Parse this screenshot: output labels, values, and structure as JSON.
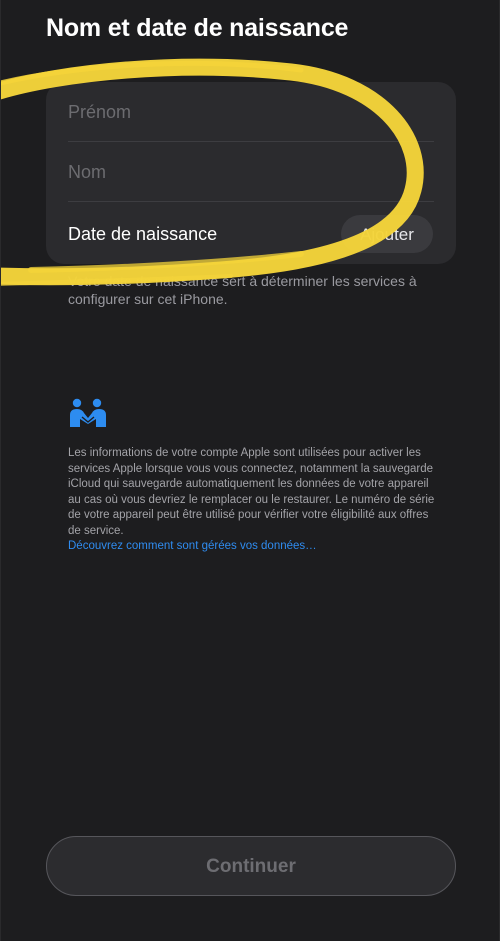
{
  "header": {
    "title": "Nom et date de naissance"
  },
  "form": {
    "first_name_placeholder": "Prénom",
    "last_name_placeholder": "Nom",
    "birth_date_label": "Date de naissance",
    "add_button_label": "Ajouter"
  },
  "helper": {
    "text": "Votre date de naissance sert à déterminer les services à configurer sur cet iPhone."
  },
  "privacy": {
    "icon": "people-handshake-icon",
    "text": "Les informations de votre compte Apple sont utilisées pour activer les services Apple lorsque vous vous connectez, notamment la sauvegarde iCloud qui sauvegarde automatiquement les données de votre appareil au cas où vous devriez le remplacer ou le restaurer. Le numéro de série de votre appareil peut être utilisé pour vérifier votre éligibilité aux offres de service.",
    "link_label": "Découvrez comment sont gérées vos données…"
  },
  "footer": {
    "continue_label": "Continuer"
  },
  "colors": {
    "background": "#1d1d1f",
    "card": "#2b2b2e",
    "link": "#2f8cf0",
    "annotation_yellow": "#f4d43a",
    "icon_blue": "#2d8cf0"
  }
}
